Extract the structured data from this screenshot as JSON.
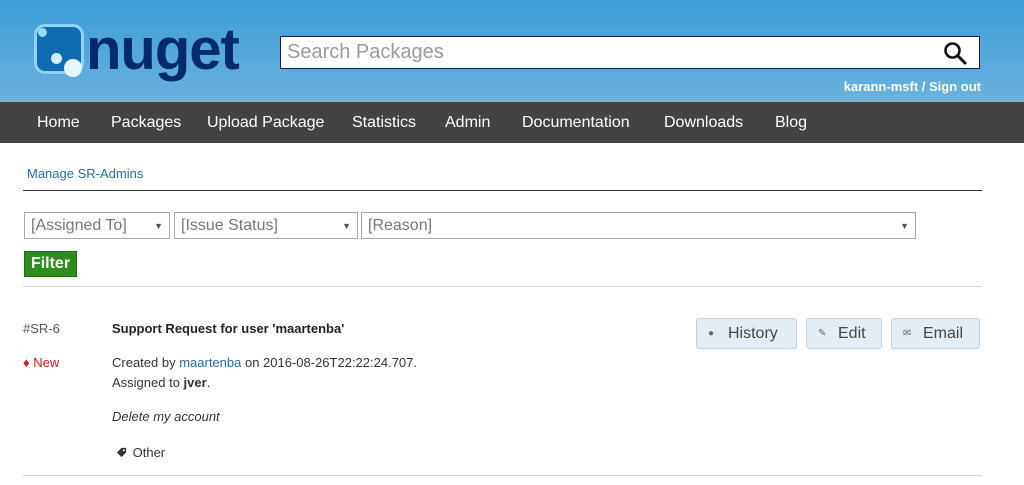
{
  "header": {
    "logo_text": "nuget",
    "search_placeholder": "Search Packages",
    "user_name": "karann-msft",
    "separator": " / ",
    "sign_out": "Sign out"
  },
  "nav": {
    "items": [
      "Home",
      "Packages",
      "Upload Package",
      "Statistics",
      "Admin",
      "Documentation",
      "Downloads",
      "Blog"
    ]
  },
  "breadcrumb": {
    "manage_link": "Manage SR-Admins"
  },
  "filters": {
    "assigned_to": "[Assigned To]",
    "issue_status": "[Issue Status]",
    "reason": "[Reason]",
    "filter_button": "Filter"
  },
  "issue": {
    "id": "#SR-6",
    "status": "New",
    "status_icon": "♦",
    "title": "Support Request for user 'maartenba'",
    "created_prefix": "Created by ",
    "created_by": "maartenba",
    "created_suffix": " on 2016-08-26T22:22:24.707.",
    "assigned_prefix": "Assigned to ",
    "assigned_to": "jver",
    "assigned_suffix": ".",
    "comment": "Delete my account",
    "reason": "Other",
    "actions": {
      "history": "History",
      "edit": "Edit",
      "email": "Email"
    }
  },
  "icons": {
    "search": "search-icon",
    "status": "diamond-icon",
    "reason": "tag-icon",
    "history": "clock-icon",
    "edit": "pencil-icon",
    "email": "envelope-icon"
  },
  "colors": {
    "header_top": "#3d9cd6",
    "nav_background": "#434343",
    "link": "#2b6ca6",
    "status_new": "#d11a1a",
    "filter_button": "#2e8b1e"
  }
}
